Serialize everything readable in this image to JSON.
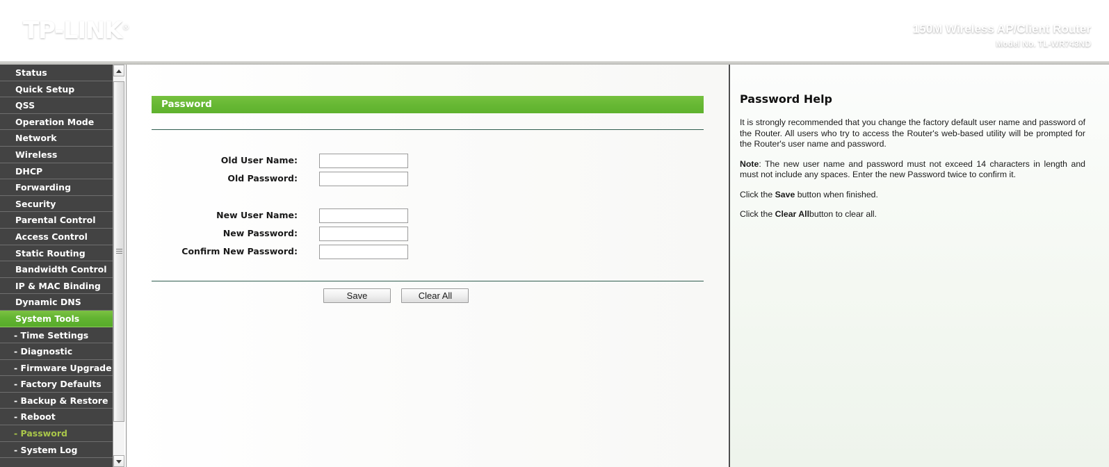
{
  "header": {
    "logo_text": "TP-LINK",
    "logo_mark": "®",
    "product_name": "150M Wireless AP/Client Router",
    "product_model": "Model No. TL-WR743ND",
    "brand_green": "#1d8840",
    "accent_green": "#66b733"
  },
  "sidebar": {
    "items": [
      {
        "label": "Status",
        "type": "parent",
        "state": "normal"
      },
      {
        "label": "Quick Setup",
        "type": "parent",
        "state": "normal"
      },
      {
        "label": "QSS",
        "type": "parent",
        "state": "normal"
      },
      {
        "label": "Operation Mode",
        "type": "parent",
        "state": "normal"
      },
      {
        "label": "Network",
        "type": "parent",
        "state": "normal"
      },
      {
        "label": "Wireless",
        "type": "parent",
        "state": "normal"
      },
      {
        "label": "DHCP",
        "type": "parent",
        "state": "normal"
      },
      {
        "label": "Forwarding",
        "type": "parent",
        "state": "normal"
      },
      {
        "label": "Security",
        "type": "parent",
        "state": "normal"
      },
      {
        "label": "Parental Control",
        "type": "parent",
        "state": "normal"
      },
      {
        "label": "Access Control",
        "type": "parent",
        "state": "normal"
      },
      {
        "label": "Static Routing",
        "type": "parent",
        "state": "normal"
      },
      {
        "label": "Bandwidth Control",
        "type": "parent",
        "state": "normal"
      },
      {
        "label": "IP & MAC Binding",
        "type": "parent",
        "state": "normal"
      },
      {
        "label": "Dynamic DNS",
        "type": "parent",
        "state": "normal"
      },
      {
        "label": "System Tools",
        "type": "parent",
        "state": "selected"
      },
      {
        "label": "- Time Settings",
        "type": "sub",
        "state": "normal"
      },
      {
        "label": "- Diagnostic",
        "type": "sub",
        "state": "normal"
      },
      {
        "label": "- Firmware Upgrade",
        "type": "sub",
        "state": "normal"
      },
      {
        "label": "- Factory Defaults",
        "type": "sub",
        "state": "normal"
      },
      {
        "label": "- Backup & Restore",
        "type": "sub",
        "state": "normal"
      },
      {
        "label": "- Reboot",
        "type": "sub",
        "state": "normal"
      },
      {
        "label": "- Password",
        "type": "sub",
        "state": "active"
      },
      {
        "label": "- System Log",
        "type": "sub",
        "state": "normal"
      }
    ],
    "selected_parent_color": "#66b733",
    "active_sub_color": "#a9c64a"
  },
  "main": {
    "panel_title": "Password",
    "fields_old": [
      {
        "label": "Old User Name:",
        "value": "",
        "placeholder": ""
      },
      {
        "label": "Old Password:",
        "value": "",
        "placeholder": ""
      }
    ],
    "fields_new": [
      {
        "label": "New User Name:",
        "value": "",
        "placeholder": ""
      },
      {
        "label": "New Password:",
        "value": "",
        "placeholder": ""
      },
      {
        "label": "Confirm New Password:",
        "value": "",
        "placeholder": ""
      }
    ],
    "buttons": {
      "save_label": "Save",
      "clear_label": "Clear All"
    }
  },
  "help": {
    "title": "Password Help",
    "paragraph_1": "It is strongly recommended that you change the factory default user name and password of the Router. All users who try to access the Router's web-based utility will be prompted for the Router's user name and password.",
    "note_label": "Note",
    "note_rest": ": The new user name and password must not exceed 14 characters in length and must not include any spaces. Enter the new Password twice to confirm it.",
    "click_save_pre": "Click the ",
    "click_save_bold": "Save",
    "click_save_post": " button when finished.",
    "click_clear_pre": "Click the ",
    "click_clear_bold": "Clear All",
    "click_clear_post": "button to clear all."
  },
  "scrollbar": {
    "up_icon": "triangle-up-icon",
    "down_icon": "triangle-down-icon"
  }
}
